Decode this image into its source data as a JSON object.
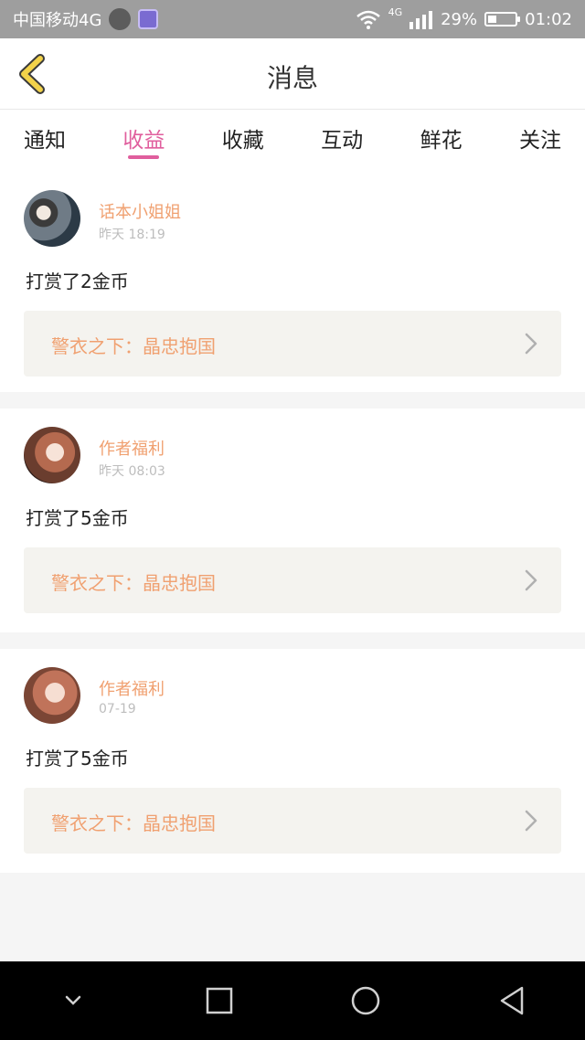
{
  "status_bar": {
    "carrier": "中国移动4G",
    "signal_label": "4G",
    "battery": "29%",
    "time": "01:02"
  },
  "header": {
    "title": "消息"
  },
  "tabs": [
    {
      "label": "通知"
    },
    {
      "label": "收益"
    },
    {
      "label": "收藏"
    },
    {
      "label": "互动"
    },
    {
      "label": "鲜花"
    },
    {
      "label": "关注"
    }
  ],
  "active_tab_index": 1,
  "messages": [
    {
      "user": "话本小姐姐",
      "time": "昨天 18:19",
      "content": "打赏了2金币",
      "book": "警衣之下：晶忠抱国"
    },
    {
      "user": "作者福利",
      "time": "昨天 08:03",
      "content": "打赏了5金币",
      "book": "警衣之下：晶忠抱国"
    },
    {
      "user": "作者福利",
      "time": "07-19",
      "content": "打赏了5金币",
      "book": "警衣之下：晶忠抱国"
    }
  ],
  "colors": {
    "accent": "#e05e9d",
    "book_link": "#f0a070",
    "back_arrow": "#f2d24a",
    "back_arrow_stroke": "#3a3a3a"
  },
  "system_nav": {
    "back_icon": "triangle-back-icon",
    "home_icon": "circle-home-icon",
    "recents_icon": "square-recents-icon",
    "collapse_icon": "chevron-down-icon"
  }
}
